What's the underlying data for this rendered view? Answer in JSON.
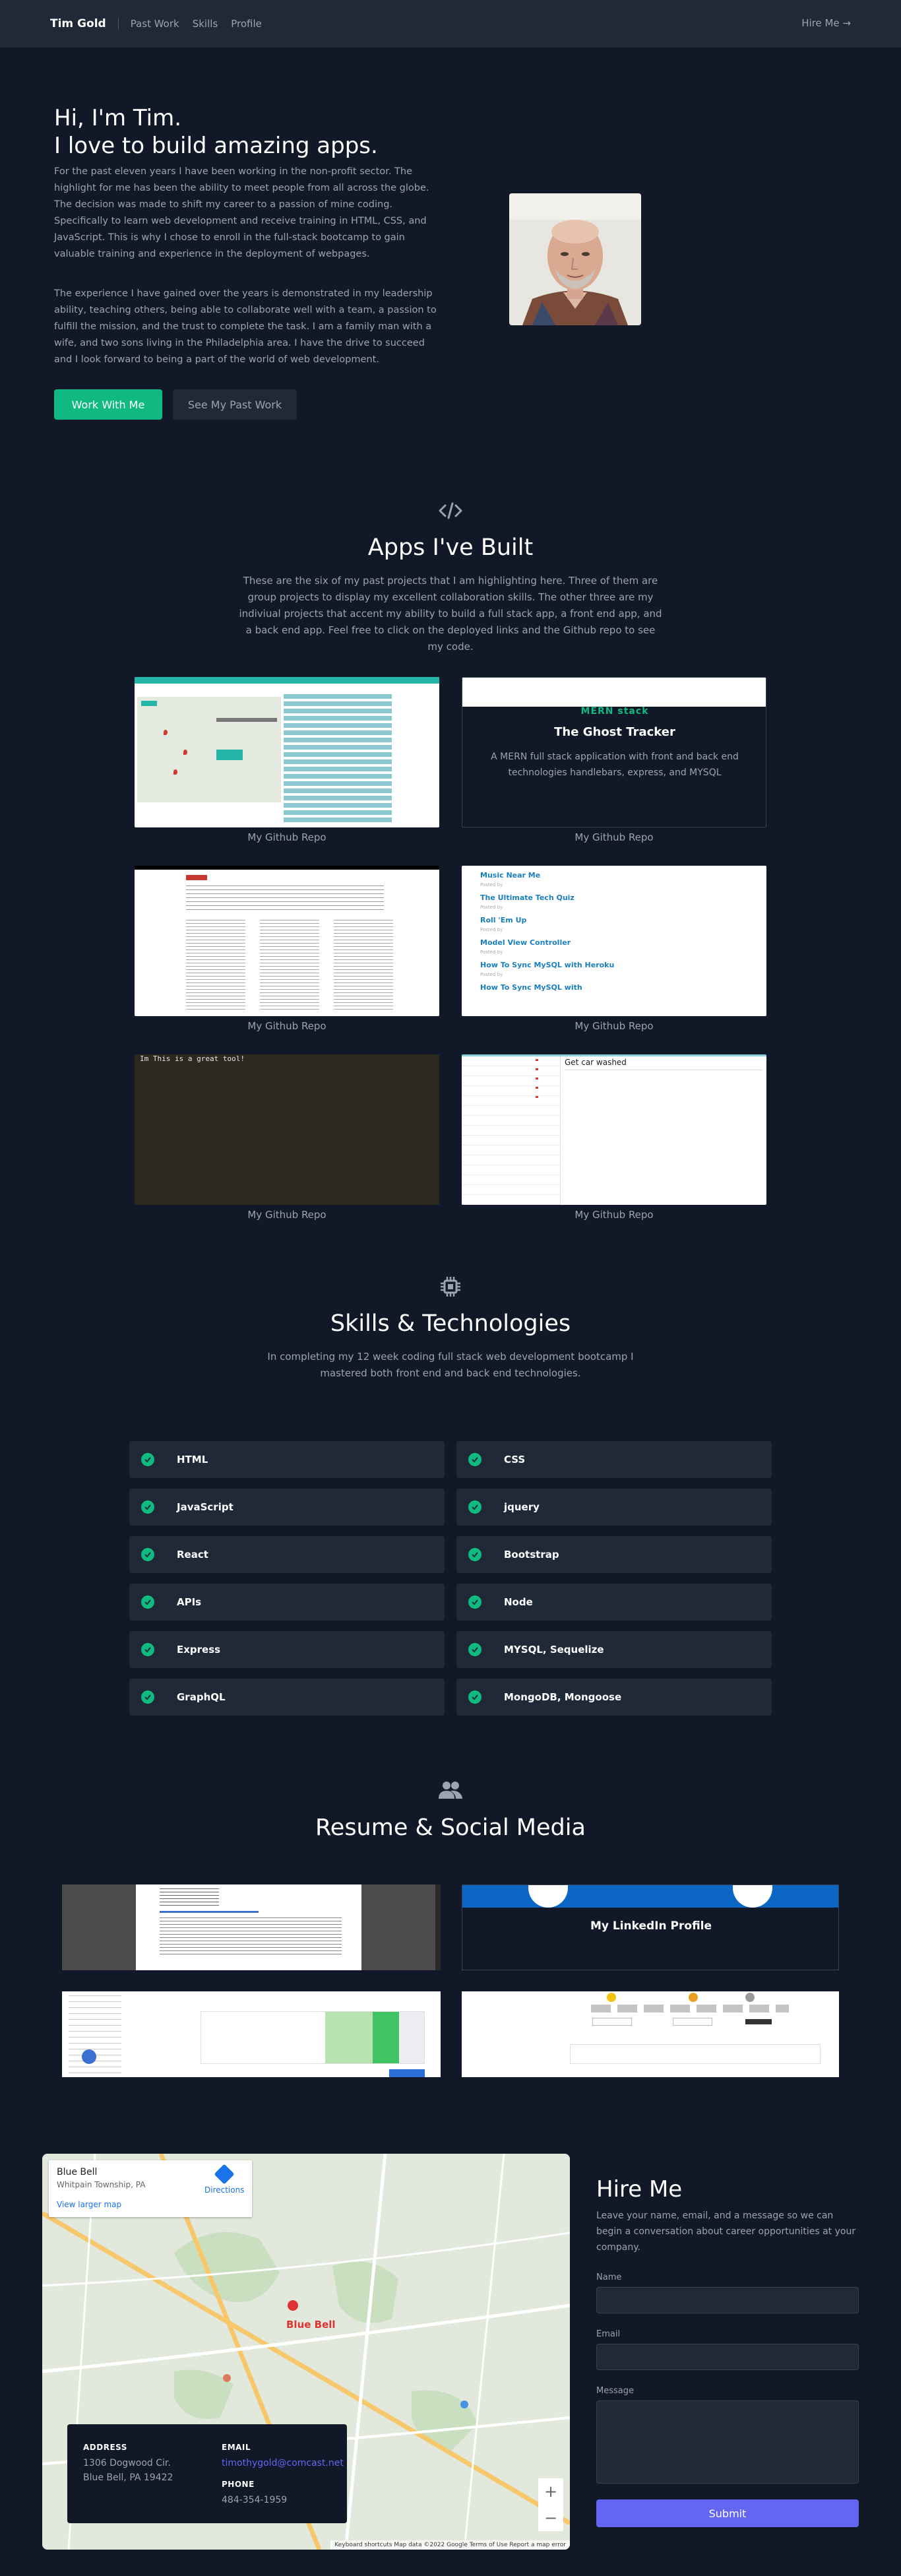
{
  "nav": {
    "brand": "Tim Gold",
    "links": [
      "Past Work",
      "Skills",
      "Profile"
    ],
    "hire": "Hire Me →"
  },
  "hero": {
    "title_line1": "Hi, I'm Tim.",
    "title_line2": "I love to build amazing apps.",
    "para1": "For the past eleven years I have been working in the non-profit sector. The highlight for me has been the ability to meet people from all across the globe. The decision was made to shift my career to a passion of mine coding. Specifically to learn web development and receive training in HTML, CSS, and JavaScript. This is why I chose to enroll in the full-stack bootcamp to gain valuable training and experience in the deployment of webpages.",
    "para2": "The experience I have gained over the years is demonstrated in my leadership ability, teaching others, being able to collaborate well with a team, a passion to fulfill the mission, and the trust to complete the task. I am a family man with a wife, and two sons living in the Philadelphia area. I have the drive to succeed and I look forward to being a part of the world of web development.",
    "btn_primary": "Work With Me",
    "btn_secondary": "See My Past Work"
  },
  "apps": {
    "title": "Apps I've Built",
    "subtitle": "These are the six of my past projects that I am highlighting here. Three of them are group projects to display my excellent collaboration skills. The other three are my indiviual projects that accent my ability to build a full stack app, a front end app, and a back end app. Feel free to click on the deployed links and the Github repo to see my code.",
    "repo_label": "My Github Repo",
    "ghost": {
      "tag": "MERN stack",
      "title": "The Ghost Tracker",
      "desc": "A MERN full stack application with front and back end technologies handlebars, express, and MYSQL"
    },
    "blog_posts": [
      "Music Near Me",
      "The Ultimate Tech Quiz",
      "Roll 'Em Up",
      "Model View Controller",
      "How To Sync MySQL with Heroku",
      "How To Sync MySQL with"
    ],
    "terminal_text": "Im This is a great tool!",
    "todo_text": "Get car washed"
  },
  "skills": {
    "title": "Skills & Technologies",
    "subtitle": "In completing my 12 week coding full stack web development bootcamp I mastered both front end and back end technologies.",
    "items": [
      "HTML",
      "CSS",
      "JavaScript",
      "jquery",
      "React",
      "Bootstrap",
      "APIs",
      "Node",
      "Express",
      "MYSQL, Sequelize",
      "GraphQL",
      "MongoDB, Mongoose"
    ]
  },
  "resume": {
    "title": "Resume & Social Media",
    "linkedin": "My LinkedIn Profile"
  },
  "map": {
    "place": "Blue Bell",
    "place_sub": "Whitpain Township, PA",
    "directions": "Directions",
    "larger": "View larger map",
    "town": "Blue Bell",
    "footer": "Keyboard shortcuts   Map data ©2022 Google   Terms of Use   Report a map error"
  },
  "contact": {
    "address_h": "ADDRESS",
    "address_l1": "1306 Dogwood Cir.",
    "address_l2": "Blue Bell, PA 19422",
    "email_h": "EMAIL",
    "email": "timothygold@comcast.net",
    "phone_h": "PHONE",
    "phone": "484-354-1959"
  },
  "hire": {
    "title": "Hire Me",
    "desc": "Leave your name, email, and a message so we can begin a conversation about career opportunities at your company.",
    "name_label": "Name",
    "email_label": "Email",
    "message_label": "Message",
    "submit": "Submit"
  }
}
